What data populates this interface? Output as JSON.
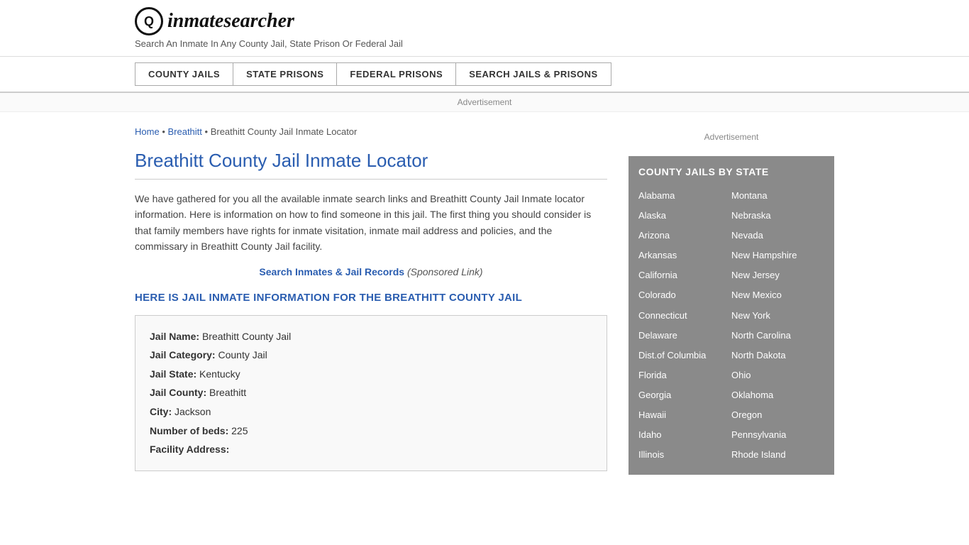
{
  "header": {
    "logo_icon": "🔍",
    "logo_text_prefix": "inmate",
    "logo_text_suffix": "searcher",
    "tagline": "Search An Inmate In Any County Jail, State Prison Or Federal Jail"
  },
  "nav": {
    "items": [
      {
        "id": "county-jails",
        "label": "COUNTY JAILS"
      },
      {
        "id": "state-prisons",
        "label": "STATE PRISONS"
      },
      {
        "id": "federal-prisons",
        "label": "FEDERAL PRISONS"
      },
      {
        "id": "search-jails",
        "label": "SEARCH JAILS & PRISONS"
      }
    ]
  },
  "ad_bar": {
    "label": "Advertisement"
  },
  "breadcrumb": {
    "home": "Home",
    "separator": "•",
    "breathitt": "Breathitt",
    "current": "Breathitt County Jail Inmate Locator"
  },
  "page_title": "Breathitt County Jail Inmate Locator",
  "description": "We have gathered for you all the available inmate search links and Breathitt County Jail Inmate locator information. Here is information on how to find someone in this jail. The first thing you should consider is that family members have rights for inmate visitation, inmate mail address and policies, and the commissary in Breathitt County Jail facility.",
  "search_link": {
    "text": "Search Inmates & Jail Records",
    "sponsored": "(Sponsored Link)"
  },
  "info_heading": "HERE IS JAIL INMATE INFORMATION FOR THE BREATHITT COUNTY JAIL",
  "jail_info": {
    "name_label": "Jail Name:",
    "name_value": "Breathitt County Jail",
    "category_label": "Jail Category:",
    "category_value": "County Jail",
    "state_label": "Jail State:",
    "state_value": "Kentucky",
    "county_label": "Jail County:",
    "county_value": "Breathitt",
    "city_label": "City:",
    "city_value": "Jackson",
    "beds_label": "Number of beds:",
    "beds_value": "225",
    "address_label": "Facility Address:"
  },
  "sidebar": {
    "ad_label": "Advertisement",
    "state_list_title": "COUNTY JAILS BY STATE",
    "left_column": [
      "Alabama",
      "Alaska",
      "Arizona",
      "Arkansas",
      "California",
      "Colorado",
      "Connecticut",
      "Delaware",
      "Dist.of Columbia",
      "Florida",
      "Georgia",
      "Hawaii",
      "Idaho",
      "Illinois"
    ],
    "right_column": [
      "Montana",
      "Nebraska",
      "Nevada",
      "New Hampshire",
      "New Jersey",
      "New Mexico",
      "New York",
      "North Carolina",
      "North Dakota",
      "Ohio",
      "Oklahoma",
      "Oregon",
      "Pennsylvania",
      "Rhode Island"
    ]
  }
}
